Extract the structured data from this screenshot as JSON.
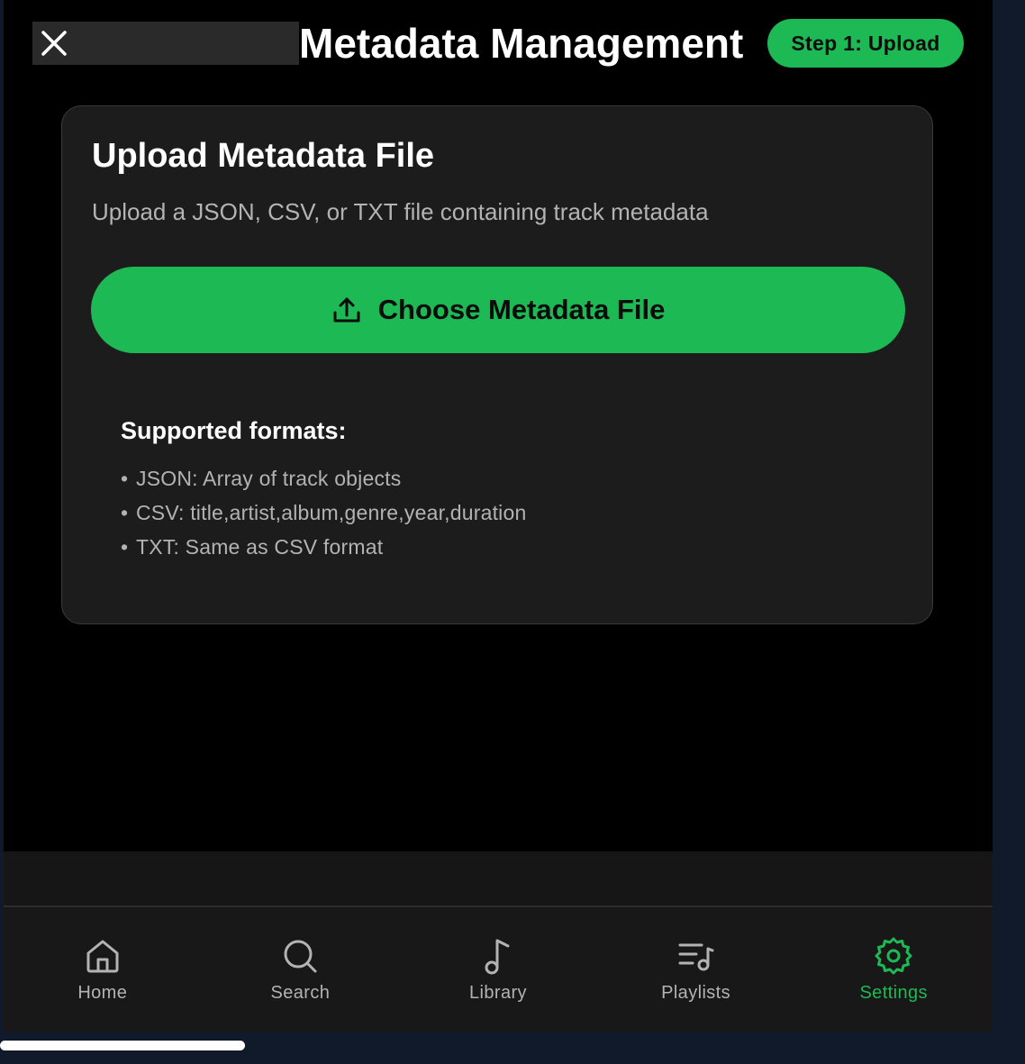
{
  "header": {
    "title": "Metadata Management",
    "step_badge": "Step 1: Upload",
    "close_icon": "close-icon"
  },
  "card": {
    "title": "Upload Metadata File",
    "subtitle": "Upload a JSON, CSV, or TXT file containing track metadata",
    "upload_button": {
      "label": "Choose Metadata File",
      "icon": "upload-icon"
    },
    "formats": {
      "title": "Supported formats:",
      "items": [
        "JSON: Array of track objects",
        "CSV: title,artist,album,genre,year,duration",
        "TXT: Same as CSV format"
      ]
    }
  },
  "tabs": [
    {
      "label": "Home",
      "icon": "home-icon",
      "active": false
    },
    {
      "label": "Search",
      "icon": "search-icon",
      "active": false
    },
    {
      "label": "Library",
      "icon": "music-note-icon",
      "active": false
    },
    {
      "label": "Playlists",
      "icon": "playlist-icon",
      "active": false
    },
    {
      "label": "Settings",
      "icon": "gear-icon",
      "active": true
    }
  ],
  "colors": {
    "accent": "#1db954",
    "background": "#000000",
    "card": "#1c1c1c",
    "muted_text": "#b3b3b3"
  }
}
